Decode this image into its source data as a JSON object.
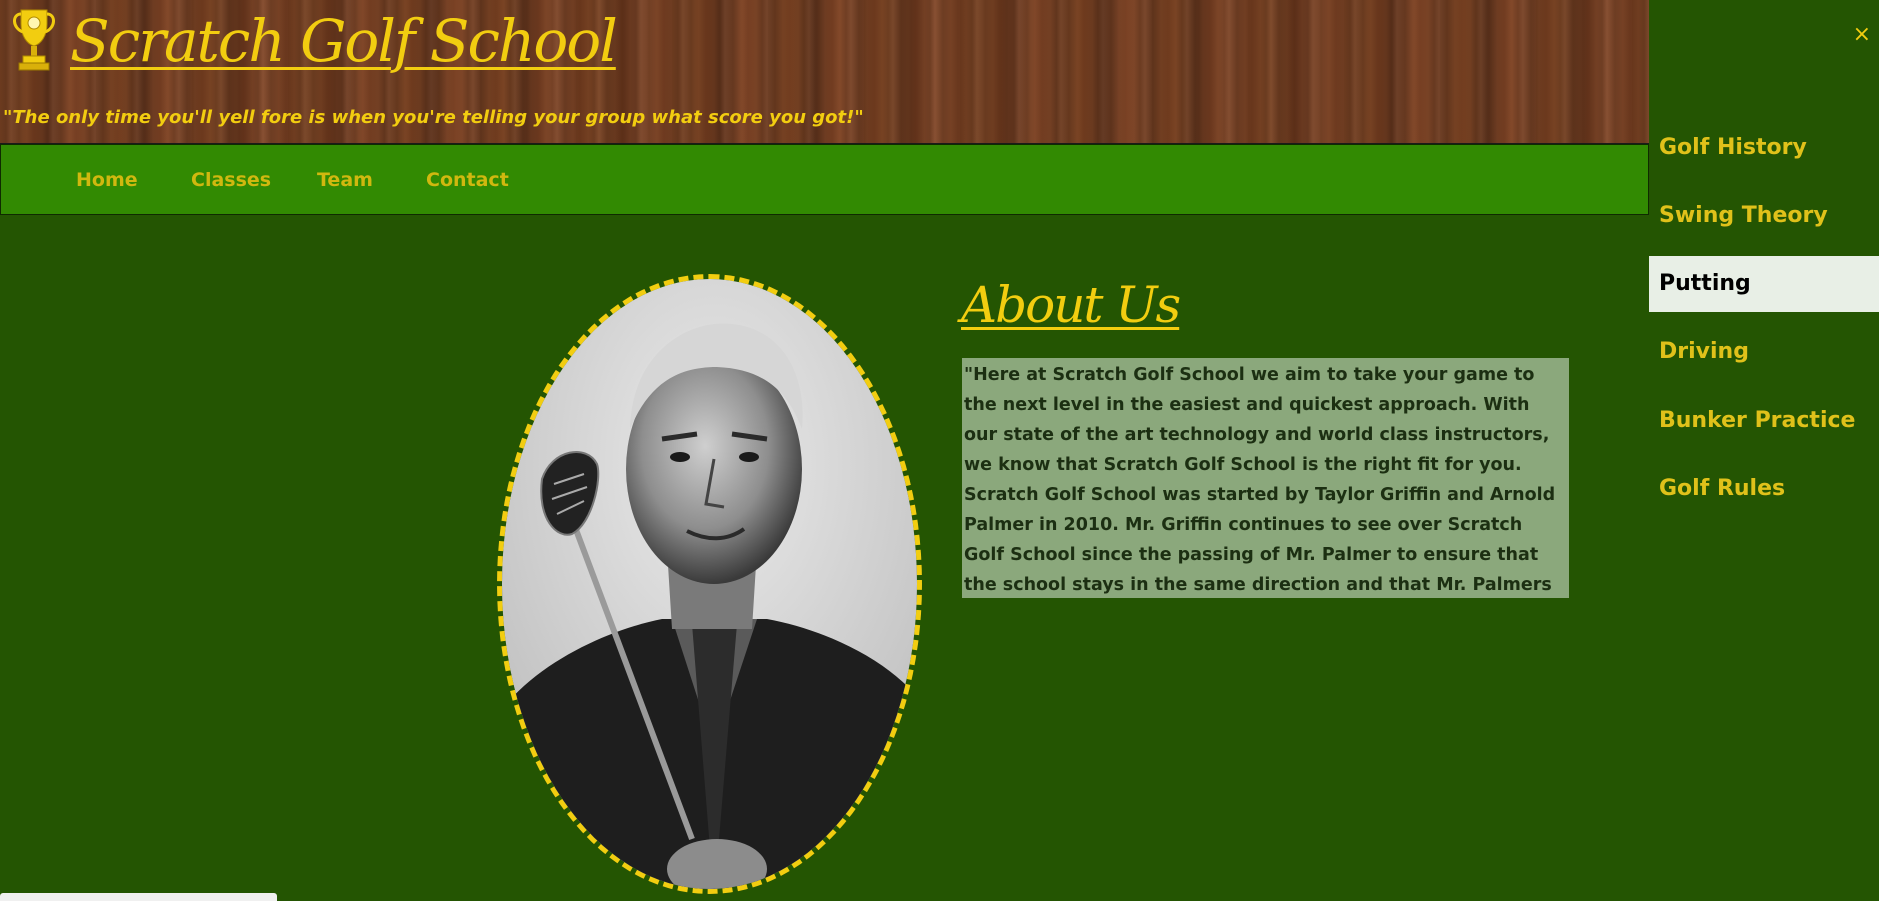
{
  "header": {
    "title": "Scratch Golf School",
    "tagline": "\"The only time you'll yell fore is when you're telling your group what score you got!\"",
    "logo_icon": "trophy-icon"
  },
  "nav": {
    "items": [
      {
        "label": "Home"
      },
      {
        "label": "Classes"
      },
      {
        "label": "Team"
      },
      {
        "label": "Contact"
      }
    ]
  },
  "about": {
    "title": "About Us",
    "text": "\"Here at Scratch Golf School we aim to take your game to the next level in the easiest and quickest approach. With our state of the art technology and world class instructors, we know that Scratch Golf School is the right fit for you. Scratch Golf School was started by Taylor Griffin and Arnold Palmer in 2010. Mr. Griffin continues to see over Scratch Golf School since the passing of Mr. Palmer to ensure that the school stays in the same direction and that Mr. Palmers legacy lives on. \""
  },
  "side_menu": {
    "close_label": "×",
    "items": [
      {
        "label": "Golf History",
        "active": false
      },
      {
        "label": "Swing Theory",
        "active": false
      },
      {
        "label": "Putting",
        "active": true
      },
      {
        "label": "Driving",
        "active": false
      },
      {
        "label": "Bunker Practice",
        "active": false
      },
      {
        "label": "Golf Rules",
        "active": false
      }
    ]
  },
  "colors": {
    "page_bg": "#245502",
    "nav_bg": "#328a02",
    "accent_gold": "#f2cd10",
    "about_box_bg": "#8ba87c",
    "active_item_bg": "#e8efe6"
  }
}
